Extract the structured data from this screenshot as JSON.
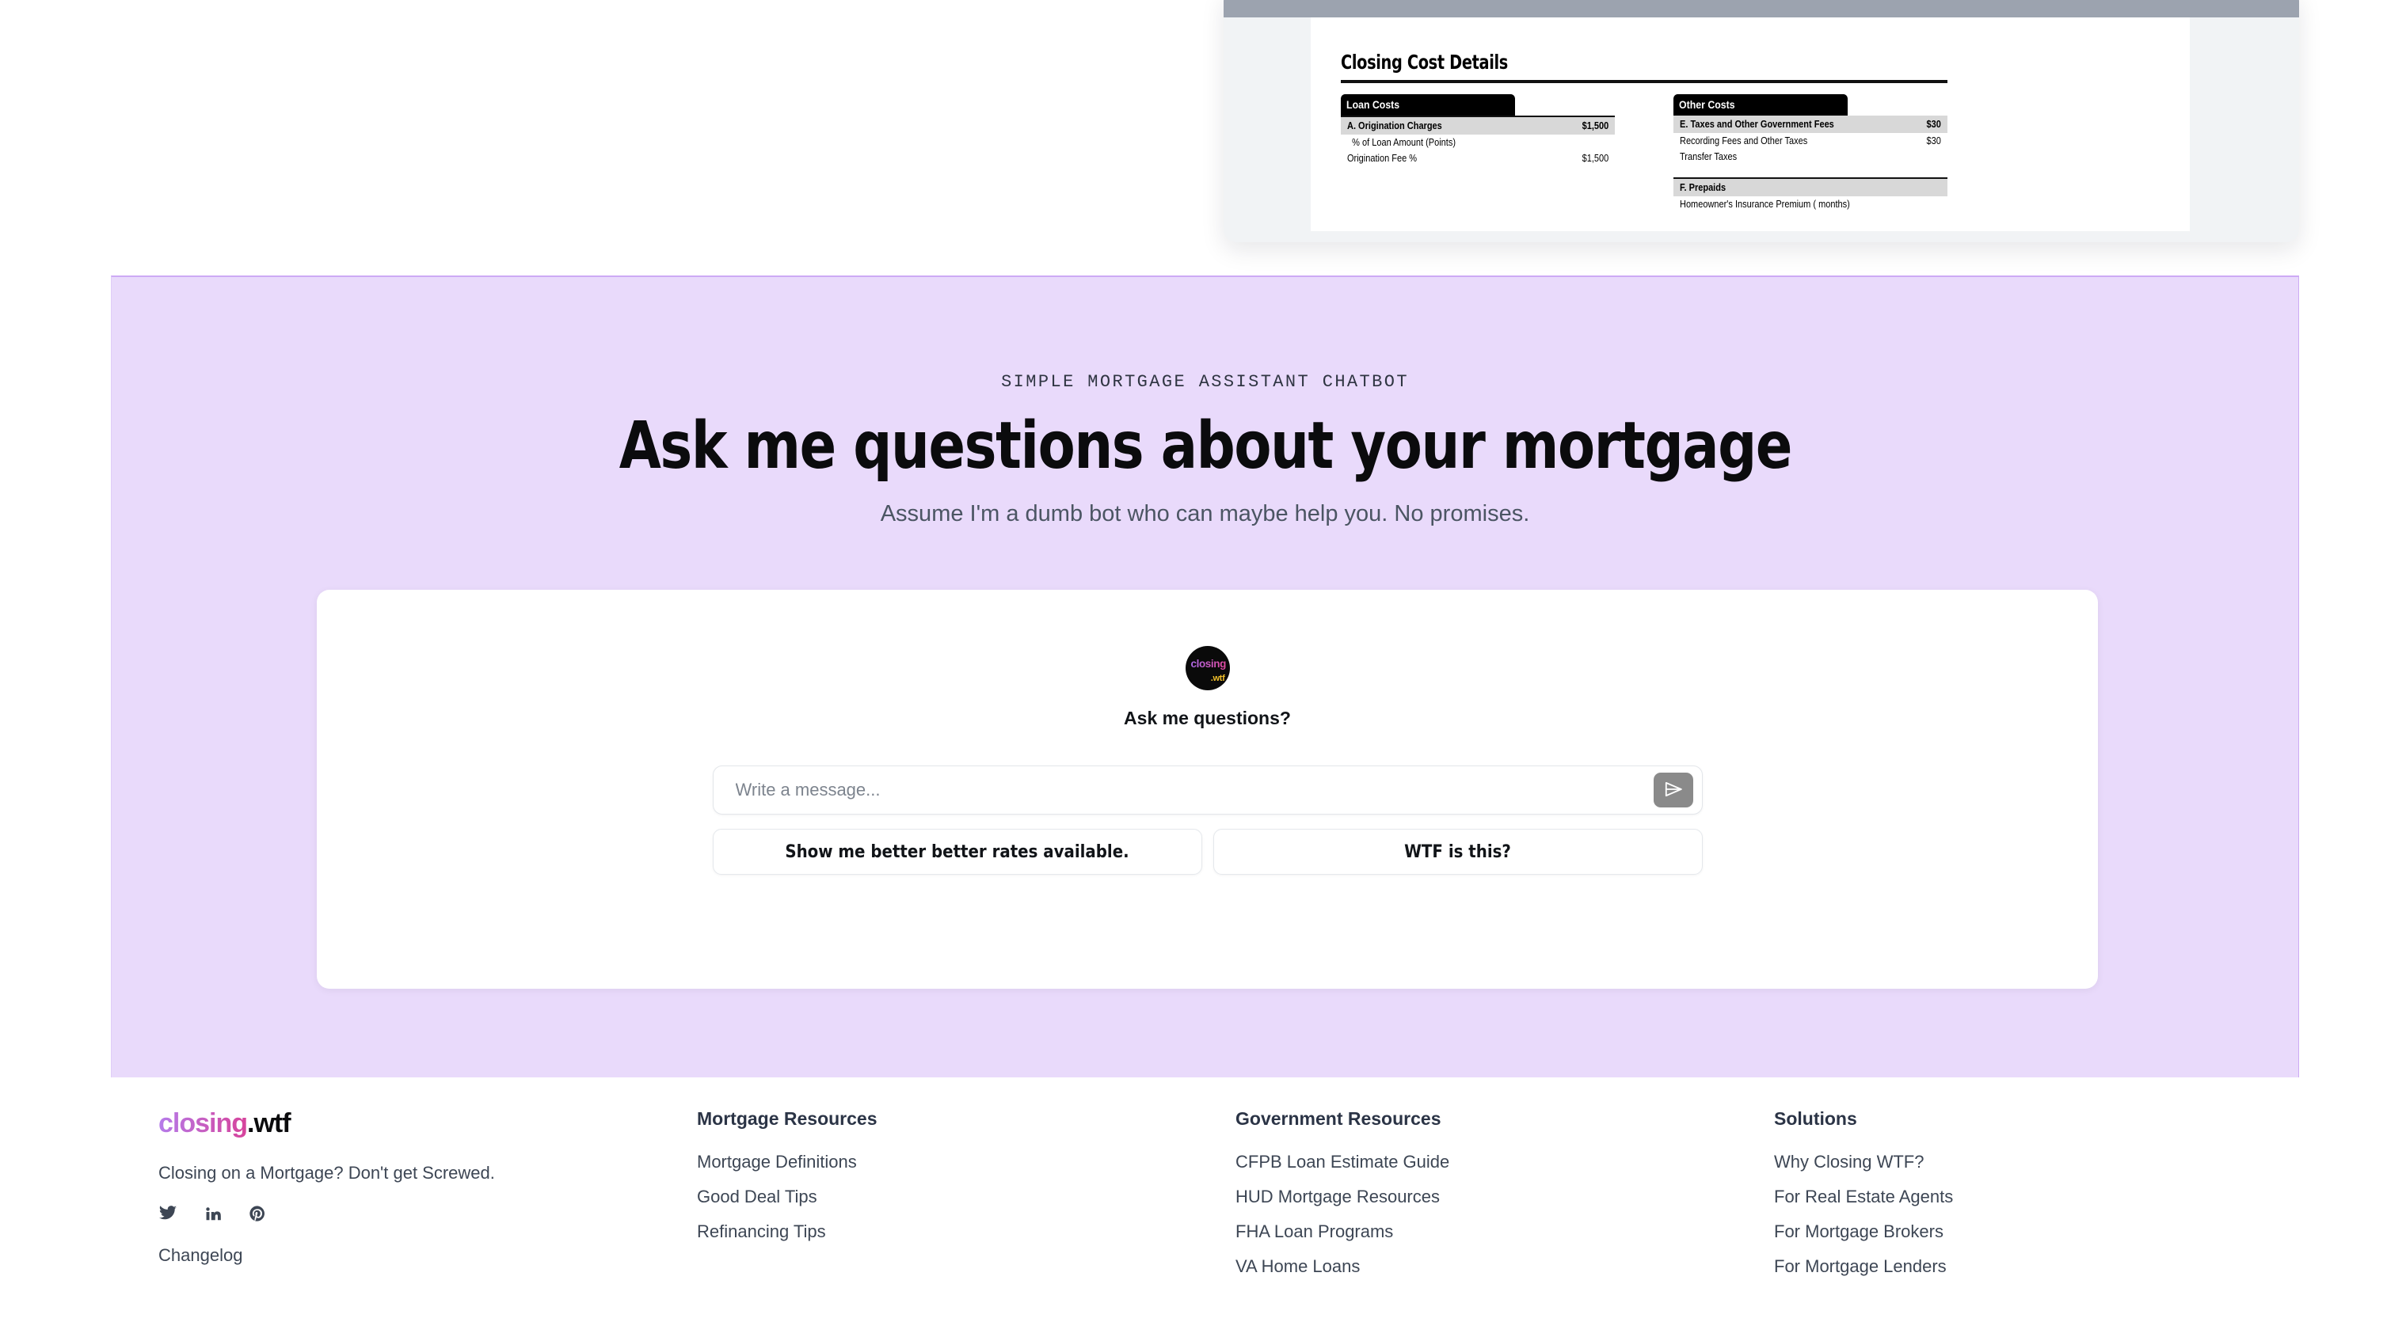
{
  "doc_preview": {
    "title": "Closing Cost Details",
    "loan_costs": {
      "heading": "Loan Costs",
      "rows": [
        {
          "label": "A. Origination Charges",
          "amount": "$1,500",
          "type": "section"
        },
        {
          "label": "% of Loan Amount (Points)",
          "amount": "",
          "type": "sub-indent"
        },
        {
          "label": "Origination Fee %",
          "amount": "$1,500",
          "type": "sub"
        }
      ]
    },
    "other_costs": {
      "heading": "Other Costs",
      "rows": [
        {
          "label": "E. Taxes and Other Government Fees",
          "amount": "$30",
          "type": "section"
        },
        {
          "label": "Recording Fees and Other Taxes",
          "amount": "$30",
          "type": "sub"
        },
        {
          "label": "Transfer Taxes",
          "amount": "",
          "type": "sub"
        },
        {
          "label": "F. Prepaids",
          "amount": "",
          "type": "section"
        },
        {
          "label": "Homeowner's Insurance Premium (  months)",
          "amount": "",
          "type": "sub"
        }
      ]
    }
  },
  "hero": {
    "eyebrow": "SIMPLE MORTGAGE ASSISTANT CHATBOT",
    "title": "Ask me questions about your mortgage",
    "subtitle": "Assume I'm a dumb bot who can maybe help you. No promises.",
    "accent_bg": "#e9dafb"
  },
  "chat": {
    "avatar": {
      "word": "closing",
      "tld": ".wtf"
    },
    "greeting": "Ask me questions?",
    "input": {
      "value": "",
      "placeholder": "Write a message..."
    },
    "send_button_label": "Send",
    "suggestions": [
      "Show me better better rates available.",
      "WTF is this?"
    ]
  },
  "footer": {
    "brand": {
      "logo_word": "closing",
      "logo_tld": ".wtf",
      "tagline": "Closing on a Mortgage? Don't get Screwed.",
      "changelog": "Changelog",
      "social": [
        "twitter-icon",
        "linkedin-icon",
        "pinterest-icon"
      ]
    },
    "columns": [
      {
        "title": "Mortgage Resources",
        "links": [
          "Mortgage Definitions",
          "Good Deal Tips",
          "Refinancing Tips"
        ]
      },
      {
        "title": "Government Resources",
        "links": [
          "CFPB Loan Estimate Guide",
          "HUD Mortgage Resources",
          "FHA Loan Programs",
          "VA Home Loans"
        ]
      },
      {
        "title": "Solutions",
        "links": [
          "Why Closing WTF?",
          "For Real Estate Agents",
          "For Mortgage Brokers",
          "For Mortgage Lenders"
        ]
      }
    ]
  }
}
